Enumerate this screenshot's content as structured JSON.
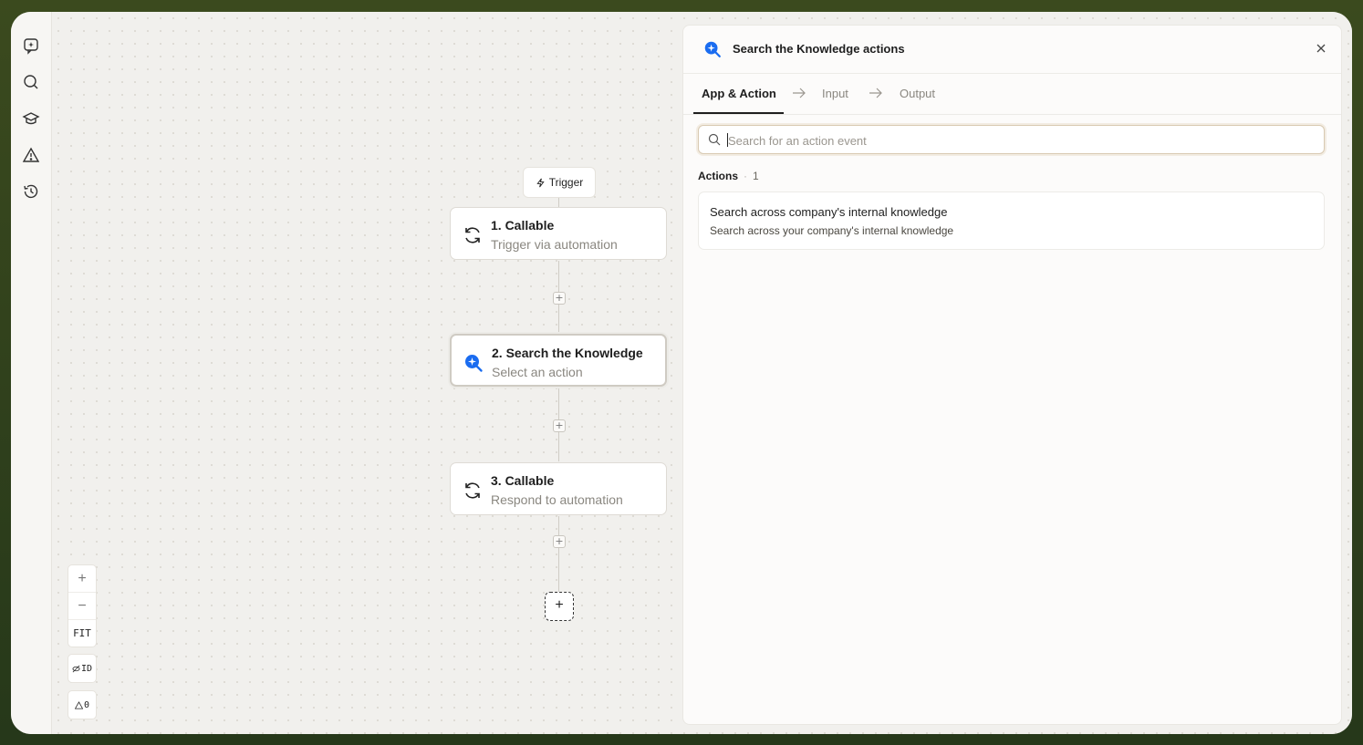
{
  "colors": {
    "accent_blue": "#1a6cf0",
    "frame_bg": "#3b4a1e"
  },
  "rail": {
    "icons": [
      "sparkle-chat-icon",
      "search-icon",
      "graduation-cap-icon",
      "warning-icon",
      "history-icon"
    ]
  },
  "canvas": {
    "trigger_chip": {
      "label": "Trigger"
    },
    "nodes": [
      {
        "title": "1. Callable",
        "subtitle": "Trigger via automation",
        "icon": "refresh-icon"
      },
      {
        "title": "2. Search the Knowledge",
        "subtitle": "Select an action",
        "icon": "knowledge-search-icon"
      },
      {
        "title": "3. Callable",
        "subtitle": "Respond to automation",
        "icon": "refresh-icon"
      }
    ],
    "zoom": {
      "in": "+",
      "out": "−",
      "fit": "FIT"
    },
    "id_toggle": "ID",
    "warnings_count": "0"
  },
  "panel": {
    "title": "Search the Knowledge actions",
    "tabs": [
      "App & Action",
      "Input",
      "Output"
    ],
    "search": {
      "placeholder": "Search for an action event",
      "value": ""
    },
    "actions_label": "Actions",
    "actions_count": "1",
    "actions": [
      {
        "title": "Search across company's internal knowledge",
        "description": "Search across your company's internal knowledge"
      }
    ]
  }
}
